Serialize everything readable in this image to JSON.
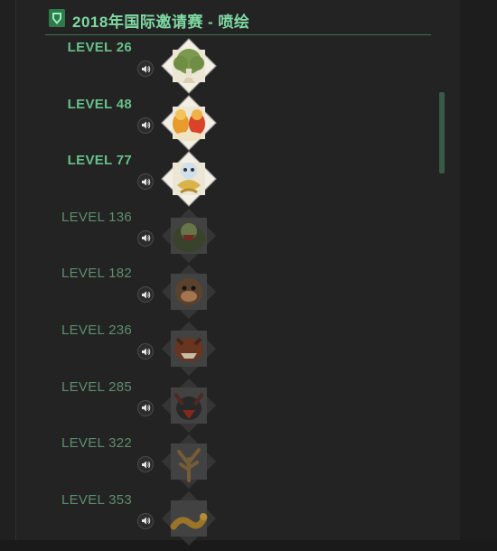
{
  "header": {
    "title": "2018年国际邀请赛 - 喷绘",
    "icon": "green-shield-icon",
    "accent_color": "#7fd9a3"
  },
  "sprays": [
    {
      "level": "LEVEL 26",
      "unlocked": true,
      "icon": "tree-spray-icon"
    },
    {
      "level": "LEVEL 48",
      "unlocked": true,
      "icon": "monkeys-spray-icon"
    },
    {
      "level": "LEVEL 77",
      "unlocked": true,
      "icon": "snake-creature-spray-icon"
    },
    {
      "level": "LEVEL 136",
      "unlocked": false,
      "icon": "ogre-spray-icon"
    },
    {
      "level": "LEVEL 182",
      "unlocked": false,
      "icon": "ape-face-spray-icon"
    },
    {
      "level": "LEVEL 236",
      "unlocked": false,
      "icon": "beast-spray-icon"
    },
    {
      "level": "LEVEL 285",
      "unlocked": false,
      "icon": "horned-monster-spray-icon"
    },
    {
      "level": "LEVEL 322",
      "unlocked": false,
      "icon": "dead-tree-spray-icon"
    },
    {
      "level": "LEVEL 353",
      "unlocked": false,
      "icon": "coiled-serpent-spray-icon"
    }
  ]
}
